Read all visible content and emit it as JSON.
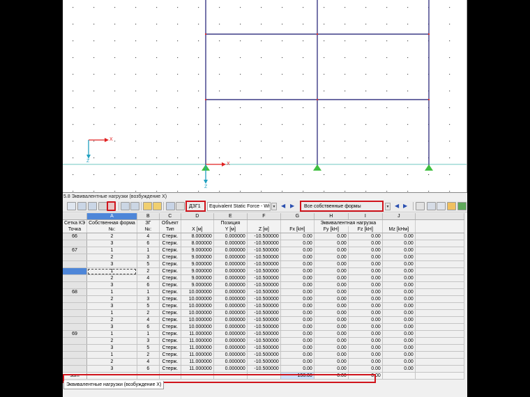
{
  "panel": {
    "title": "5.8 Эквивалентные нагрузки (возбуждение X)",
    "bottom_tab": "Эквивалентные нагрузки (возбуждение X)"
  },
  "toolbar": {
    "case_id": "ДЗГ1",
    "case_name": "Equivalent Static Force - Wit",
    "mode_filter": "Все собственные формы"
  },
  "view": {
    "axis_x": "X",
    "axis_z": "Z"
  },
  "table": {
    "col_letters": [
      "A",
      "B",
      "C",
      "D",
      "E",
      "F",
      "G",
      "H",
      "I",
      "J"
    ],
    "header1": {
      "fe_grid": "Сетка КЭ",
      "eigenmode": "Собственная форма",
      "floor": "ЗГ",
      "object": "Объект",
      "position": "Позиция",
      "equiv_load": "Эквивалентная нагрузка"
    },
    "header2": {
      "point": "Точка",
      "no": "№:",
      "floor_no": "№:",
      "type": "Тип",
      "x": "X [м]",
      "y": "Y [м]",
      "z": "Z [м]",
      "fx": "Fx [kH]",
      "fy": "Fy [kH]",
      "fz": "Fz [kH]",
      "mz": "Mz [kHм]"
    },
    "rows": [
      {
        "pt": "66",
        "mode": "2",
        "floor": "4",
        "type": "Стерж.",
        "x": "8.000000",
        "y": "0.000000",
        "z": "-10.500000",
        "fx": "0.00",
        "fy": "0.00",
        "fz": "0.00",
        "mz": "0.00"
      },
      {
        "pt": "",
        "mode": "3",
        "floor": "6",
        "type": "Стерж.",
        "x": "8.000000",
        "y": "0.000000",
        "z": "-10.500000",
        "fx": "0.00",
        "fy": "0.00",
        "fz": "0.00",
        "mz": "0.00"
      },
      {
        "pt": "67",
        "mode": "1",
        "floor": "1",
        "type": "Стерж.",
        "x": "9.000000",
        "y": "0.000000",
        "z": "-10.500000",
        "fx": "0.00",
        "fy": "0.00",
        "fz": "0.00",
        "mz": "0.00"
      },
      {
        "pt": "",
        "mode": "2",
        "floor": "3",
        "type": "Стерж.",
        "x": "9.000000",
        "y": "0.000000",
        "z": "-10.500000",
        "fx": "0.00",
        "fy": "0.00",
        "fz": "0.00",
        "mz": "0.00"
      },
      {
        "pt": "",
        "mode": "3",
        "floor": "5",
        "type": "Стерж.",
        "x": "9.000000",
        "y": "0.000000",
        "z": "-10.500000",
        "fx": "0.00",
        "fy": "0.00",
        "fz": "0.00",
        "mz": "0.00"
      },
      {
        "pt": "",
        "mode": "1",
        "floor": "2",
        "type": "Стерж.",
        "x": "9.000000",
        "y": "0.000000",
        "z": "-10.500000",
        "fx": "0.00",
        "fy": "0.00",
        "fz": "0.00",
        "mz": "0.00"
      },
      {
        "pt": "",
        "mode": "2",
        "floor": "4",
        "type": "Стерж.",
        "x": "9.000000",
        "y": "0.000000",
        "z": "-10.500000",
        "fx": "0.00",
        "fy": "0.00",
        "fz": "0.00",
        "mz": "0.00"
      },
      {
        "pt": "",
        "mode": "3",
        "floor": "6",
        "type": "Стерж.",
        "x": "9.000000",
        "y": "0.000000",
        "z": "-10.500000",
        "fx": "0.00",
        "fy": "0.00",
        "fz": "0.00",
        "mz": "0.00"
      },
      {
        "pt": "68",
        "mode": "1",
        "floor": "1",
        "type": "Стерж.",
        "x": "10.000000",
        "y": "0.000000",
        "z": "-10.500000",
        "fx": "0.00",
        "fy": "0.00",
        "fz": "0.00",
        "mz": "0.00"
      },
      {
        "pt": "",
        "mode": "2",
        "floor": "3",
        "type": "Стерж.",
        "x": "10.000000",
        "y": "0.000000",
        "z": "-10.500000",
        "fx": "0.00",
        "fy": "0.00",
        "fz": "0.00",
        "mz": "0.00"
      },
      {
        "pt": "",
        "mode": "3",
        "floor": "5",
        "type": "Стерж.",
        "x": "10.000000",
        "y": "0.000000",
        "z": "-10.500000",
        "fx": "0.00",
        "fy": "0.00",
        "fz": "0.00",
        "mz": "0.00"
      },
      {
        "pt": "",
        "mode": "1",
        "floor": "2",
        "type": "Стерж.",
        "x": "10.000000",
        "y": "0.000000",
        "z": "-10.500000",
        "fx": "0.00",
        "fy": "0.00",
        "fz": "0.00",
        "mz": "0.00"
      },
      {
        "pt": "",
        "mode": "2",
        "floor": "4",
        "type": "Стерж.",
        "x": "10.000000",
        "y": "0.000000",
        "z": "-10.500000",
        "fx": "0.00",
        "fy": "0.00",
        "fz": "0.00",
        "mz": "0.00"
      },
      {
        "pt": "",
        "mode": "3",
        "floor": "6",
        "type": "Стерж.",
        "x": "10.000000",
        "y": "0.000000",
        "z": "-10.500000",
        "fx": "0.00",
        "fy": "0.00",
        "fz": "0.00",
        "mz": "0.00"
      },
      {
        "pt": "69",
        "mode": "1",
        "floor": "1",
        "type": "Стерж.",
        "x": "11.000000",
        "y": "0.000000",
        "z": "-10.500000",
        "fx": "0.00",
        "fy": "0.00",
        "fz": "0.00",
        "mz": "0.00"
      },
      {
        "pt": "",
        "mode": "2",
        "floor": "3",
        "type": "Стерж.",
        "x": "11.000000",
        "y": "0.000000",
        "z": "-10.500000",
        "fx": "0.00",
        "fy": "0.00",
        "fz": "0.00",
        "mz": "0.00"
      },
      {
        "pt": "",
        "mode": "3",
        "floor": "5",
        "type": "Стерж.",
        "x": "11.000000",
        "y": "0.000000",
        "z": "-10.500000",
        "fx": "0.00",
        "fy": "0.00",
        "fz": "0.00",
        "mz": "0.00"
      },
      {
        "pt": "",
        "mode": "1",
        "floor": "2",
        "type": "Стерж.",
        "x": "11.000000",
        "y": "0.000000",
        "z": "-10.500000",
        "fx": "0.00",
        "fy": "0.00",
        "fz": "0.00",
        "mz": "0.00"
      },
      {
        "pt": "",
        "mode": "2",
        "floor": "4",
        "type": "Стерж.",
        "x": "11.000000",
        "y": "0.000000",
        "z": "-10.500000",
        "fx": "0.00",
        "fy": "0.00",
        "fz": "0.00",
        "mz": "0.00"
      },
      {
        "pt": "",
        "mode": "3",
        "floor": "6",
        "type": "Стерж.",
        "x": "11.000000",
        "y": "0.000000",
        "z": "-10.500000",
        "fx": "0.00",
        "fy": "0.00",
        "fz": "0.00",
        "mz": "0.00"
      }
    ],
    "sum_row": {
      "label": "sum",
      "fx": "136.00",
      "fy": "0.00",
      "fz": "0.00"
    }
  }
}
